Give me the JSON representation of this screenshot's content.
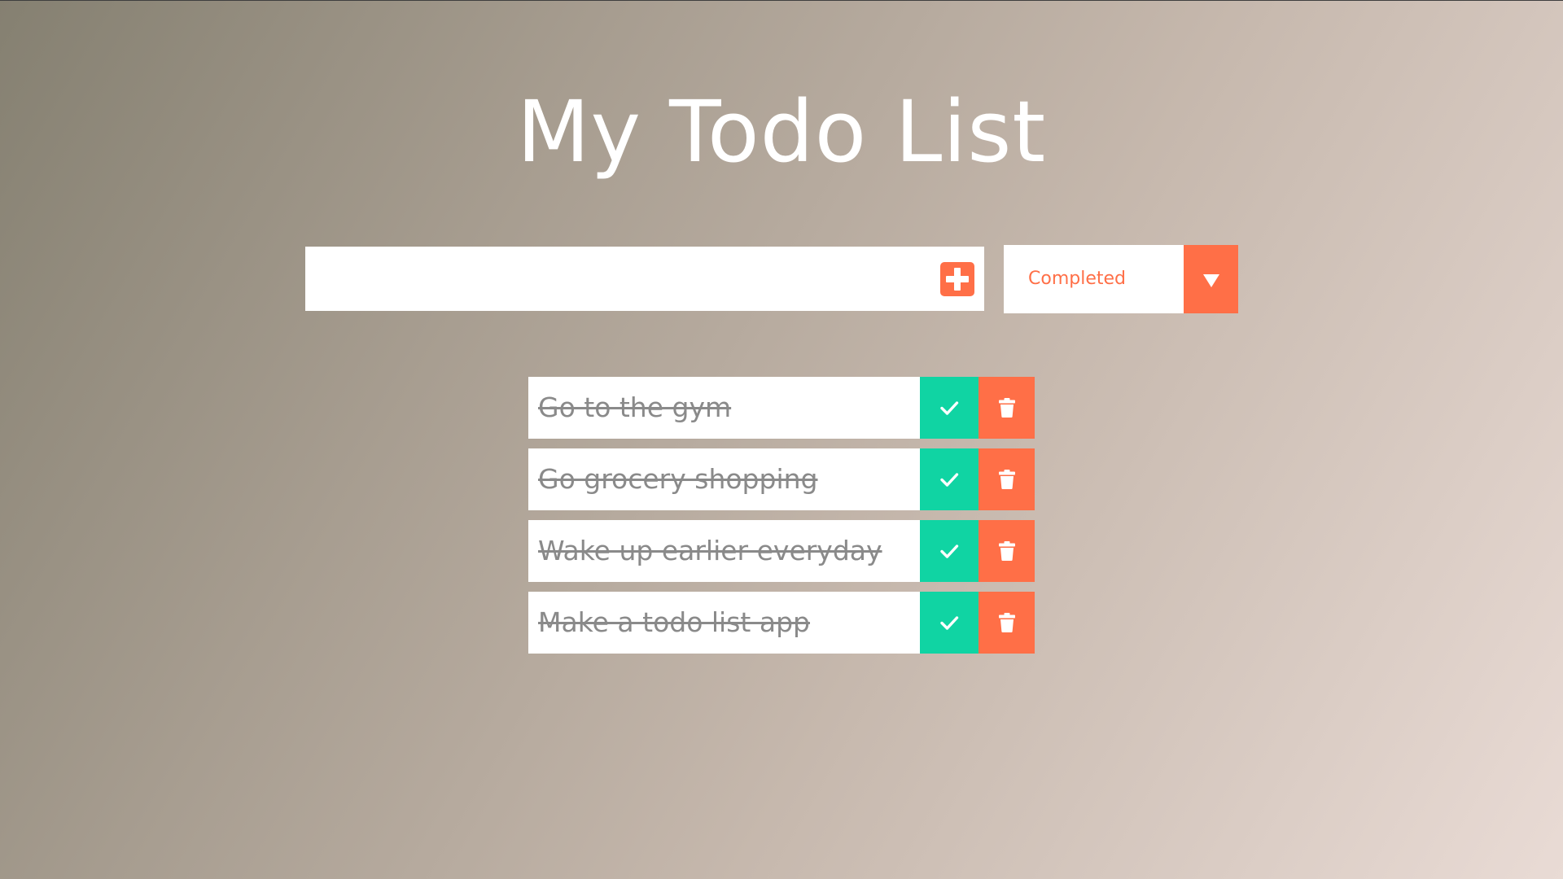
{
  "header": {
    "title": "My Todo List"
  },
  "form": {
    "input_value": "",
    "input_placeholder": "",
    "add_icon": "plus-square-icon"
  },
  "filter": {
    "selected": "Completed",
    "arrow_icon": "triangle-down-icon"
  },
  "todos": [
    {
      "text": "Go to the gym",
      "completed": true
    },
    {
      "text": "Go grocery shopping",
      "completed": true
    },
    {
      "text": "Wake up earlier everyday",
      "completed": true
    },
    {
      "text": "Make a todo list app",
      "completed": true
    }
  ],
  "icons": {
    "complete": "check-icon",
    "delete": "trash-icon"
  },
  "colors": {
    "accent": "#ff6f47",
    "check": "#10d4a3",
    "completed_text": "#8a8a8a",
    "title": "#ffffff"
  }
}
